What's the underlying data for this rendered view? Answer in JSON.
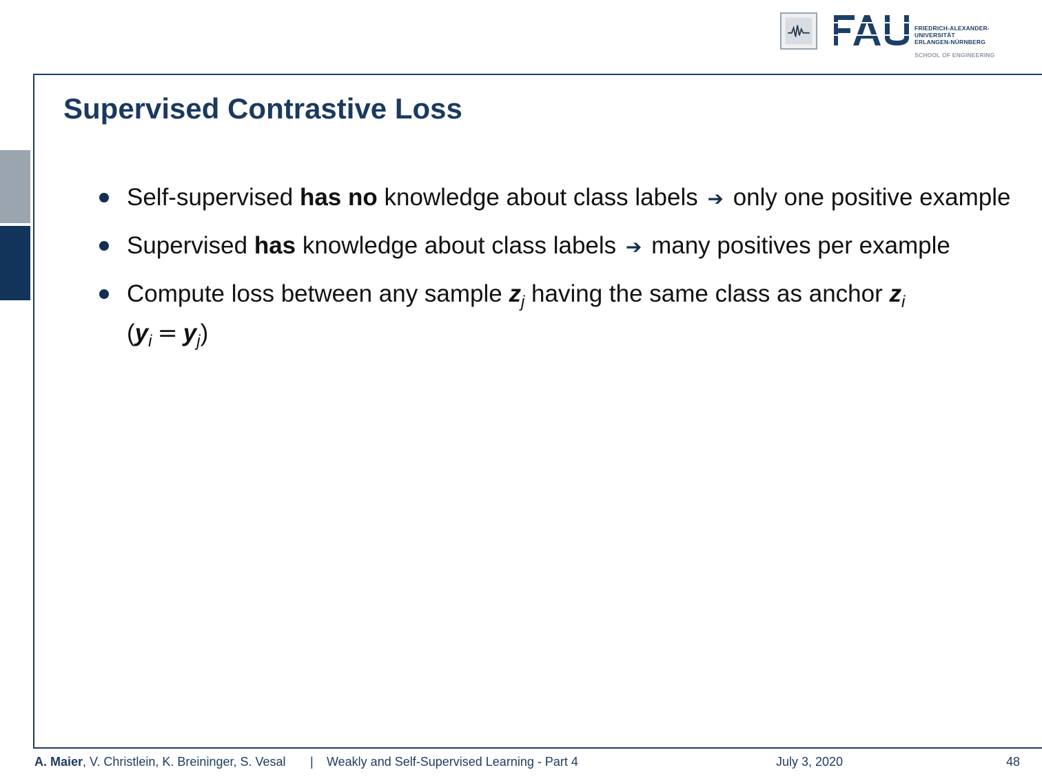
{
  "logo": {
    "mark": "FAU",
    "line1": "FRIEDRICH-ALEXANDER-",
    "line2": "UNIVERSITÄT",
    "line3": "ERLANGEN-NÜRNBERG",
    "school": "SCHOOL OF ENGINEERING",
    "seal_icon": "waveform-seal-icon"
  },
  "slide": {
    "title": "Supervised Contrastive Loss",
    "bullets": [
      {
        "t1": "Self-supervised ",
        "b1": "has no",
        "t2": " knowledge about class labels ",
        "arrow": "➔",
        "t3": " only one positive example"
      },
      {
        "t1": "Supervised ",
        "b1": "has",
        "t2": " knowledge about class labels ",
        "arrow": "➔",
        "t3": " many positives per example"
      },
      {
        "t1": "Compute loss between any sample ",
        "var1": "z",
        "sub1": "j",
        "t2": " having the same class as anchor ",
        "var2": "z",
        "sub2": "i",
        "open": "(",
        "var3": "y",
        "sub3": "i",
        "eq": "=",
        "var4": "y",
        "sub4": "j",
        "close": ")"
      }
    ]
  },
  "footer": {
    "lead_author": "A. Maier",
    "other_authors": ", V. Christlein, K. Breininger, S. Vesal",
    "separator": "|",
    "talk": "Weakly and Self-Supervised Learning - Part 4",
    "date": "July 3, 2020",
    "page": "48"
  },
  "colors": {
    "primary": "#1a3a5e",
    "side_tab_light": "#9aa5af",
    "side_tab_dark": "#13345a"
  }
}
